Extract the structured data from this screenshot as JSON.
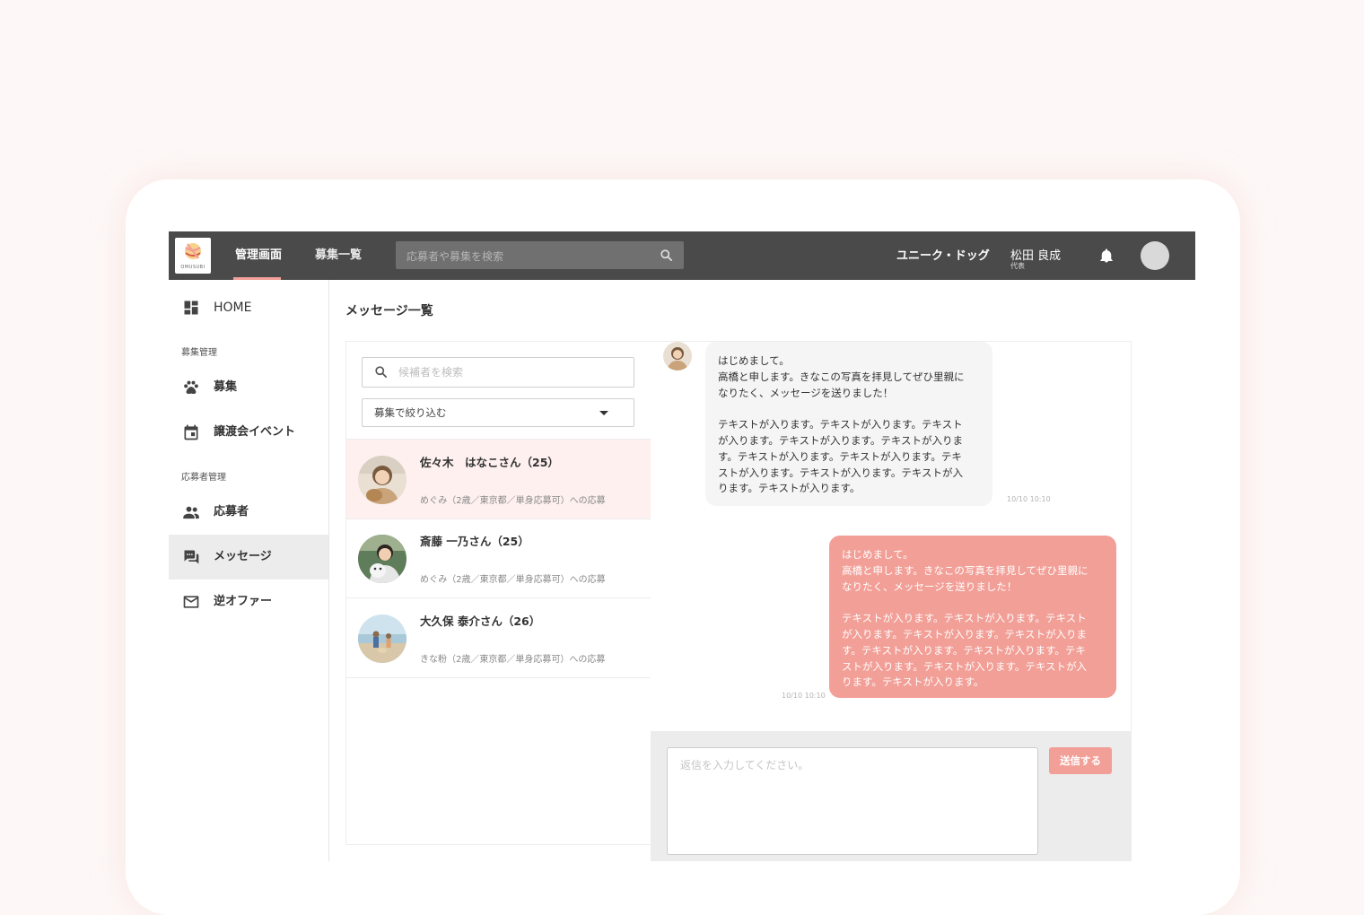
{
  "header": {
    "logo_text": "OMUSUBI",
    "nav": [
      {
        "label": "管理画面",
        "active": true
      },
      {
        "label": "募集一覧",
        "active": false
      }
    ],
    "search_placeholder": "応募者や募集を検索",
    "company": "ユニーク・ドッグ",
    "user_name": "松田 良成",
    "user_role": "代表",
    "colors": {
      "bar": "#4a4a4a",
      "accent": "#f29f97"
    }
  },
  "sidebar": {
    "home": "HOME",
    "section1": "募集管理",
    "section2": "応募者管理",
    "items": [
      {
        "label": "募集",
        "icon": "paw-icon"
      },
      {
        "label": "譲渡会イベント",
        "icon": "calendar-icon"
      },
      {
        "label": "応募者",
        "icon": "people-icon"
      },
      {
        "label": "メッセージ",
        "icon": "chat-icon",
        "active": true
      },
      {
        "label": "逆オファー",
        "icon": "mail-icon"
      }
    ]
  },
  "main": {
    "title": "メッセージ一覧",
    "candidate_search_placeholder": "候補者を検索",
    "filter_label": "募集で絞り込む",
    "candidates": [
      {
        "name": "佐々木　はなこさん（25）",
        "sub": "めぐみ（2歳／東京都／単身応募可）への応募",
        "selected": true
      },
      {
        "name": "斎藤 一乃さん（25）",
        "sub": "めぐみ（2歳／東京都／単身応募可）への応募",
        "selected": false
      },
      {
        "name": "大久保 泰介さん（26）",
        "sub": "きな粉（2歳／東京都／単身応募可）への応募",
        "selected": false
      }
    ]
  },
  "chat": {
    "messages": [
      {
        "direction": "in",
        "text": "はじめまして。\n高橋と申します。きなこの写真を拝見してぜひ里親に\nなりたく、メッセージを送りました！\n\nテキストが入ります。テキストが入ります。テキスト\nが入ります。テキストが入ります。テキストが入りま\nす。テキストが入ります。テキストが入ります。テキ\nストが入ります。テキストが入ります。テキストが入\nります。テキストが入ります。",
        "time": "10/10 10:10"
      },
      {
        "direction": "out",
        "text": "はじめまして。\n高橋と申します。きなこの写真を拝見してぜひ里親に\nなりたく、メッセージを送りました！\n\nテキストが入ります。テキストが入ります。テキスト\nが入ります。テキストが入ります。テキストが入りま\nす。テキストが入ります。テキストが入ります。テキ\nストが入ります。テキストが入ります。テキストが入\nります。テキストが入ります。",
        "time": "10/10 10:10"
      }
    ],
    "reply_placeholder": "返信を入力してください。",
    "send_label": "送信する"
  }
}
